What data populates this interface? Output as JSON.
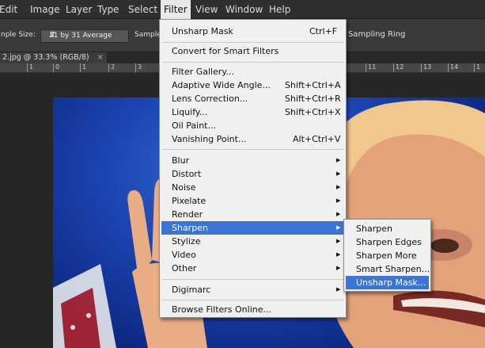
{
  "menubar": {
    "items": [
      "Edit",
      "Image",
      "Layer",
      "Type",
      "Select",
      "Filter",
      "View",
      "Window",
      "Help"
    ],
    "active": "Filter"
  },
  "options": {
    "sample_size_label": "nple Size:",
    "sample_size_value": "31 by 31 Average",
    "sample_label": "Sample",
    "sampling_ring_label": "Sampling Ring"
  },
  "document": {
    "tab_label": "2.jpg @ 33.3% (RGB/8)",
    "tab_close": "×"
  },
  "ruler": {
    "left_labels": [
      "1",
      "0",
      "1",
      "2",
      "3"
    ],
    "right_labels": [
      "11",
      "12",
      "13",
      "14",
      "1"
    ]
  },
  "filter_menu": {
    "items": [
      {
        "label": "Unsharp Mask",
        "shortcut": "Ctrl+F"
      },
      {
        "label": "Convert for Smart Filters",
        "shortcut": ""
      },
      {
        "label": "Filter Gallery...",
        "shortcut": ""
      },
      {
        "label": "Adaptive Wide Angle...",
        "shortcut": "Shift+Ctrl+A"
      },
      {
        "label": "Lens Correction...",
        "shortcut": "Shift+Ctrl+R"
      },
      {
        "label": "Liquify...",
        "shortcut": "Shift+Ctrl+X"
      },
      {
        "label": "Oil Paint...",
        "shortcut": ""
      },
      {
        "label": "Vanishing Point...",
        "shortcut": "Alt+Ctrl+V"
      },
      {
        "label": "Blur",
        "submenu": true
      },
      {
        "label": "Distort",
        "submenu": true
      },
      {
        "label": "Noise",
        "submenu": true
      },
      {
        "label": "Pixelate",
        "submenu": true
      },
      {
        "label": "Render",
        "submenu": true
      },
      {
        "label": "Sharpen",
        "submenu": true,
        "highlighted": true
      },
      {
        "label": "Stylize",
        "submenu": true
      },
      {
        "label": "Video",
        "submenu": true
      },
      {
        "label": "Other",
        "submenu": true
      },
      {
        "label": "Digimarc",
        "submenu": true
      },
      {
        "label": "Browse Filters Online...",
        "shortcut": ""
      }
    ]
  },
  "sharpen_submenu": {
    "items": [
      {
        "label": "Sharpen"
      },
      {
        "label": "Sharpen Edges"
      },
      {
        "label": "Sharpen More"
      },
      {
        "label": "Smart Sharpen..."
      },
      {
        "label": "Unsharp Mask...",
        "highlighted": true
      }
    ]
  },
  "colors": {
    "highlight": "#3c74d3",
    "menu_bg": "#f0f0f0",
    "app_bg": "#2f2f2f"
  }
}
